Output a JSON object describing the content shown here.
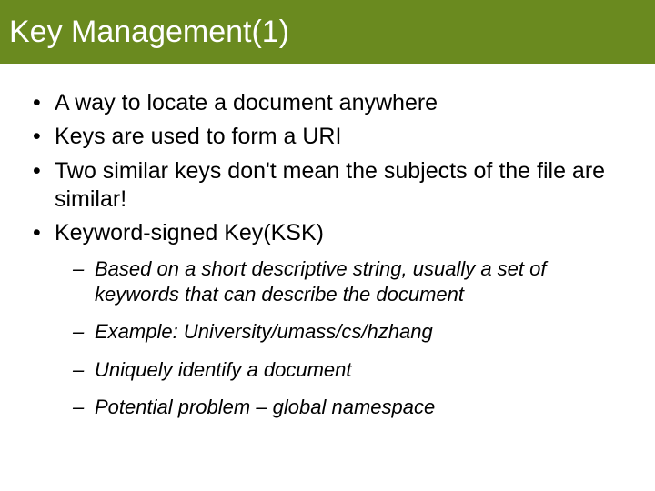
{
  "title": "Key Management(1)",
  "bullets": {
    "b0": "A way to locate a document anywhere",
    "b1": "Keys are used to form a URI",
    "b2": "Two similar keys don't mean the subjects of the file are similar!",
    "b3": "Keyword-signed Key(KSK)"
  },
  "sub": {
    "s0": "Based on a short descriptive string, usually a set of keywords that can describe the document",
    "s1": "Example: University/umass/cs/hzhang",
    "s2": "Uniquely identify a document",
    "s3": "Potential problem – global namespace"
  }
}
